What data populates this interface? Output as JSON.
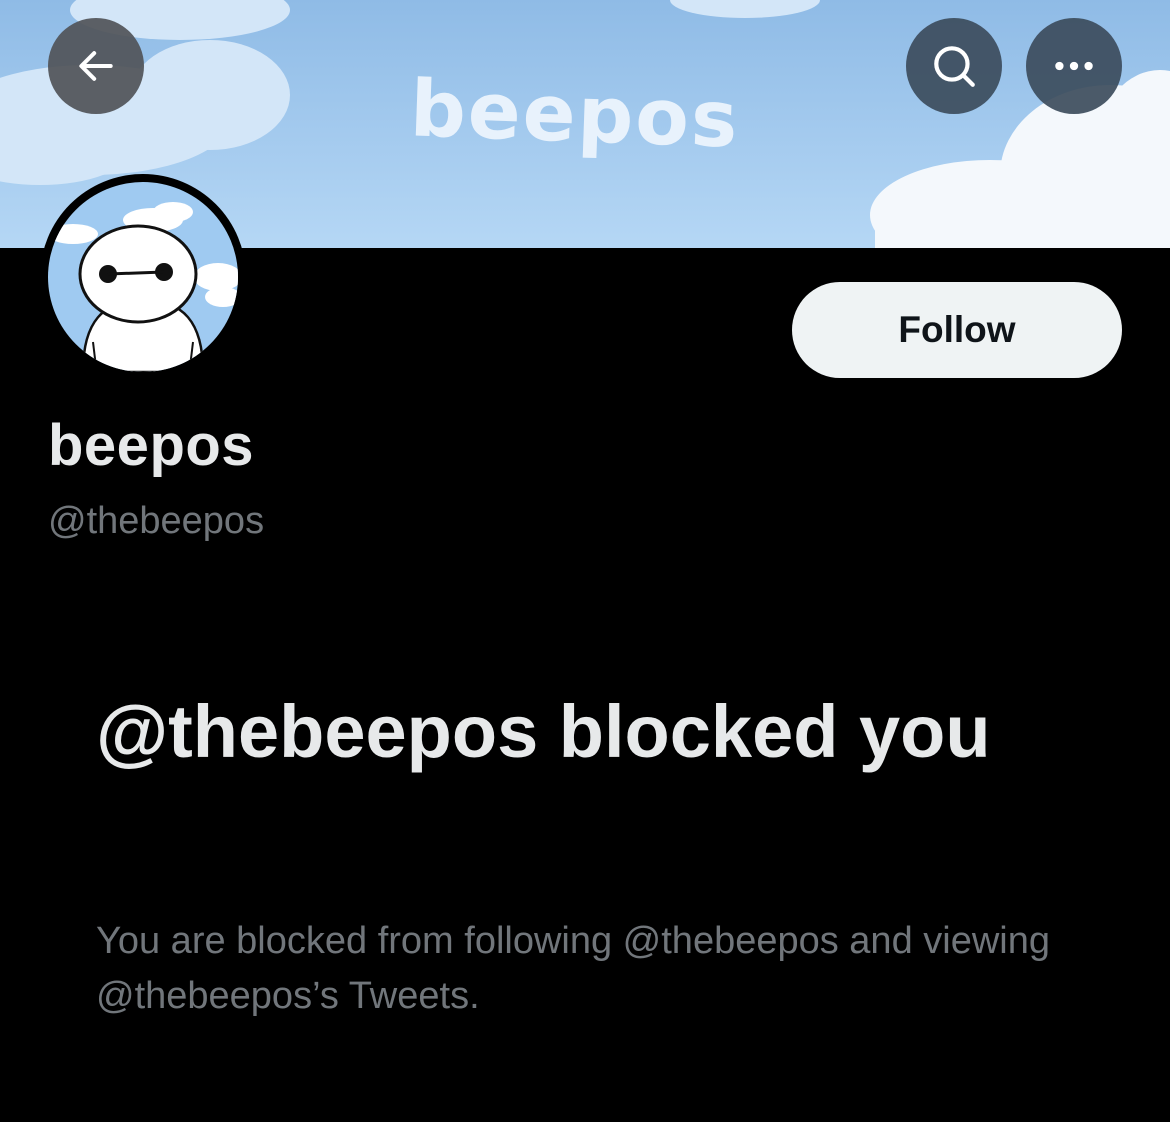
{
  "header": {
    "banner_text": "beepos",
    "back_icon": "arrow-left-icon",
    "search_icon": "search-icon",
    "more_icon": "more-horizontal-icon"
  },
  "profile": {
    "display_name": "beepos",
    "handle": "@thebeepos",
    "follow_label": "Follow"
  },
  "blocked": {
    "title": "@thebeepos blocked you",
    "description": "You are blocked from following @thebeepos and viewing @thebeepos’s Tweets."
  },
  "colors": {
    "background": "#000000",
    "sky": "#a7cdf0",
    "primary_text": "#e7e9ea",
    "secondary_text": "#71767b",
    "follow_bg": "#eff3f4"
  }
}
